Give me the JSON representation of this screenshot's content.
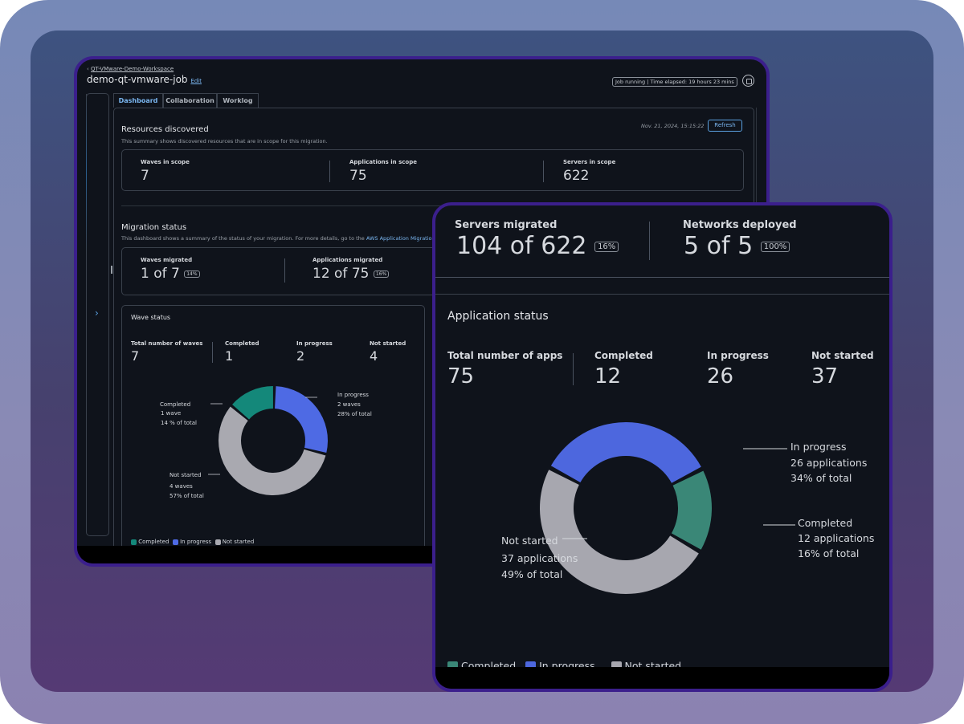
{
  "colors": {
    "completed": "#14887a",
    "in_progress": "#4e6ae4",
    "not_started": "#a9a9b0",
    "completed_zoom": "#3a8777",
    "in_progress_zoom": "#4d67de",
    "not_started_zoom": "#a7a7af",
    "accent_link": "#7ab6f0",
    "window_border": "#3b1f8c"
  },
  "header": {
    "breadcrumb_chevron": "‹",
    "breadcrumb": "QT-VMware-Demo-Workspace",
    "title": "demo-qt-vmware-job",
    "edit_link": "Edit",
    "job_status": "Job running | Time elapsed: 19 hours 23 mins",
    "stop_icon": "stop-icon"
  },
  "tabs": [
    {
      "label": "Dashboard",
      "active": true
    },
    {
      "label": "Collaboration",
      "active": false
    },
    {
      "label": "Worklog",
      "active": false
    }
  ],
  "side_panel": {
    "expand_icon": "›"
  },
  "resources": {
    "title": "Resources discovered",
    "description": "This summary shows discovered resources that are in scope for this migration.",
    "timestamp": "Nov. 21, 2024, 15:15:22",
    "refresh_label": "Refresh",
    "metrics": [
      {
        "label": "Waves in scope",
        "value": "7"
      },
      {
        "label": "Applications in scope",
        "value": "75"
      },
      {
        "label": "Servers in scope",
        "value": "622"
      }
    ]
  },
  "migration": {
    "title": "Migration status",
    "description": "This dashboard shows a summary of the status of your migration. For more details, go to the",
    "link": "AWS Application Migration",
    "metrics": [
      {
        "label": "Waves migrated",
        "value": "1 of 7",
        "badge": "14%"
      },
      {
        "label": "Applications migrated",
        "value": "12 of 75",
        "badge": "16%"
      },
      {
        "label": "Servers migrated",
        "value": "104 of 622",
        "badge": "16%"
      },
      {
        "label": "Networks deployed",
        "value": "5 of 5",
        "badge": "100%"
      }
    ]
  },
  "wave_status": {
    "title": "Wave status",
    "stats": [
      {
        "label": "Total number of waves",
        "value": "7"
      },
      {
        "label": "Completed",
        "value": "1"
      },
      {
        "label": "In progress",
        "value": "2"
      },
      {
        "label": "Not started",
        "value": "4"
      }
    ],
    "legend": [
      "Completed",
      "In progress",
      "Not started"
    ]
  },
  "app_status": {
    "title": "Application status",
    "stats": [
      {
        "label": "Total number of apps",
        "value": "75"
      },
      {
        "label": "Completed",
        "value": "12"
      },
      {
        "label": "In progress",
        "value": "26"
      },
      {
        "label": "Not started",
        "value": "37"
      }
    ],
    "legend": [
      "Completed",
      "In progress",
      "Not started"
    ]
  },
  "chart_data": [
    {
      "type": "pie",
      "title": "Wave status",
      "donut": true,
      "categories": [
        "Completed",
        "In progress",
        "Not started"
      ],
      "values": [
        1,
        2,
        4
      ],
      "unit": "wave",
      "annotations": [
        {
          "name": "Completed",
          "line1": "1 wave",
          "line2": "14 % of total"
        },
        {
          "name": "In progress",
          "line1": "2 waves",
          "line2": "28% of total"
        },
        {
          "name": "Not started",
          "line1": "4 waves",
          "line2": "57% of total"
        }
      ],
      "legend": "bottom-left"
    },
    {
      "type": "pie",
      "title": "Application status",
      "donut": true,
      "categories": [
        "In progress",
        "Completed",
        "Not started"
      ],
      "values": [
        26,
        12,
        37
      ],
      "unit": "applications",
      "annotations": [
        {
          "name": "In progress",
          "line1": "26 applications",
          "line2": "34% of total"
        },
        {
          "name": "Completed",
          "line1": "12 applications",
          "line2": "16% of total"
        },
        {
          "name": "Not started",
          "line1": "37 applications",
          "line2": "49% of total"
        }
      ],
      "legend": "bottom-left"
    }
  ]
}
